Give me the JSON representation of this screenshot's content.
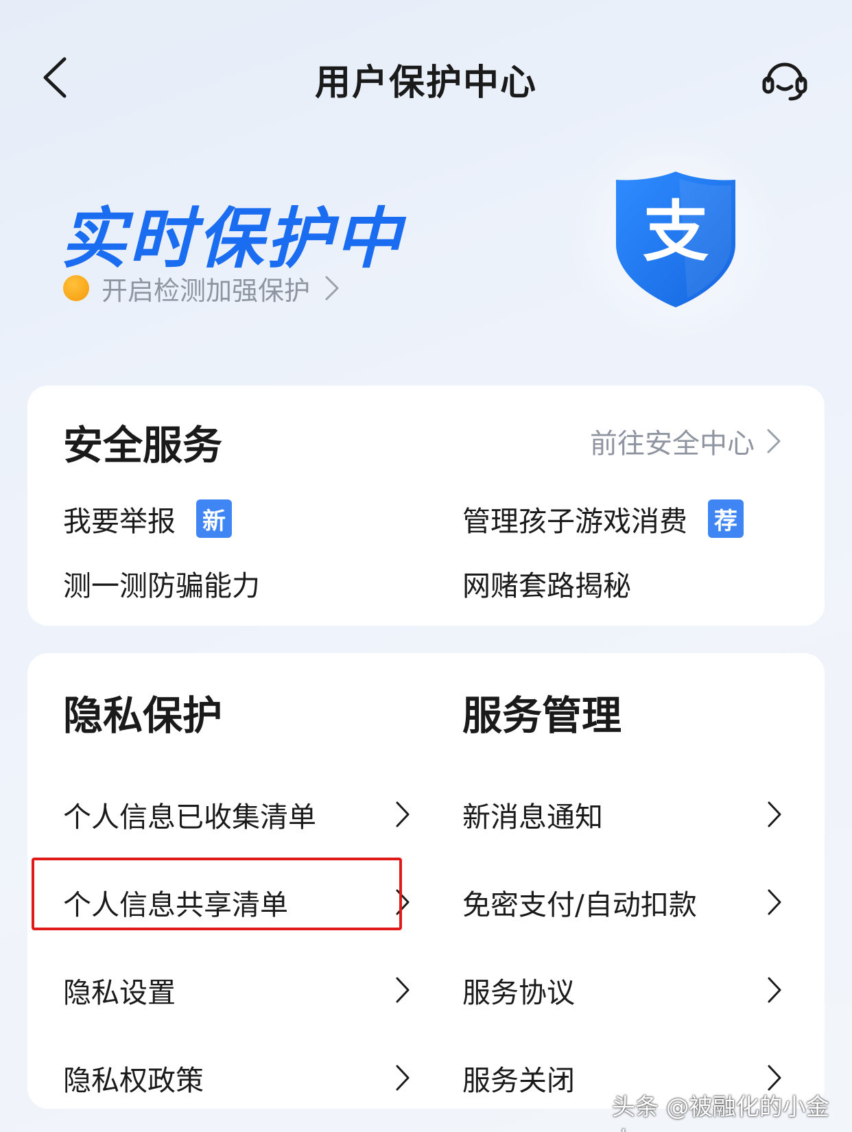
{
  "header": {
    "title": "用户保护中心"
  },
  "hero": {
    "status_title": "实时保护中",
    "detect_link": "开启检测加强保护",
    "logo_text": "支"
  },
  "security_services": {
    "title": "安全服务",
    "go_link": "前往安全中心",
    "items": [
      {
        "label": "我要举报",
        "badge": "新"
      },
      {
        "label": "管理孩子游戏消费",
        "badge": "荐"
      },
      {
        "label": "测一测防骗能力"
      },
      {
        "label": "网赌套路揭秘"
      }
    ]
  },
  "privacy": {
    "title": "隐私保护",
    "items": [
      {
        "label": "个人信息已收集清单"
      },
      {
        "label": "个人信息共享清单"
      },
      {
        "label": "隐私设置"
      },
      {
        "label": "隐私权政策"
      }
    ]
  },
  "service_management": {
    "title": "服务管理",
    "items": [
      {
        "label": "新消息通知"
      },
      {
        "label": "免密支付/自动扣款"
      },
      {
        "label": "服务协议"
      },
      {
        "label": "服务关闭"
      }
    ]
  },
  "watermark": "头条 @被融化的小金人",
  "colors": {
    "accent": "#1a6cf0",
    "badge": "#3f86f4",
    "status_dot": "#f59a0b",
    "highlight": "#e01919"
  }
}
